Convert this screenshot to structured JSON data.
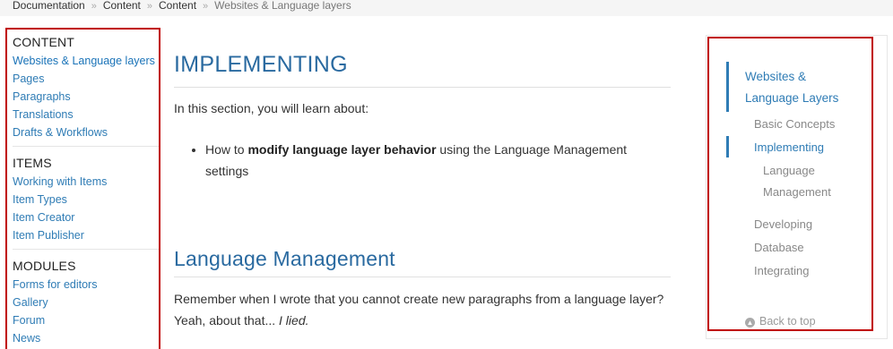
{
  "breadcrumb": [
    "Documentation",
    "Content",
    "Content",
    "Websites & Language layers"
  ],
  "sidebar": {
    "sections": [
      {
        "heading": "CONTENT",
        "items": [
          "Websites & Language layers",
          "Pages",
          "Paragraphs",
          "Translations",
          "Drafts & Workflows"
        ]
      },
      {
        "heading": "ITEMS",
        "items": [
          "Working with Items",
          "Item Types",
          "Item Creator",
          "Item Publisher"
        ]
      },
      {
        "heading": "MODULES",
        "items": [
          "Forms for editors",
          "Gallery",
          "Forum",
          "News"
        ]
      }
    ]
  },
  "main": {
    "heading_implementing": "IMPLEMENTING",
    "intro": "In this section, you will learn about:",
    "bullet": {
      "prefix": "How to ",
      "bold": "modify language layer behavior",
      "suffix": " using the Language Management settings"
    },
    "heading_language": "Language Management",
    "para_text": "Remember when I wrote that you cannot create new paragraphs from a language layer? Yeah, about that... ",
    "para_italic": "I lied."
  },
  "toc": {
    "title_line1": "Websites &",
    "title_line2": "Language Layers",
    "items": {
      "basic": "Basic Concepts",
      "implementing": "Implementing",
      "langmgmt_line1": "Language",
      "langmgmt_line2": "Management",
      "developing": "Developing",
      "database": "Database",
      "integrating": "Integrating"
    },
    "back_to_top": "Back to top"
  },
  "colors": {
    "accent": "#2f7cb5",
    "heading": "#2a6aa0",
    "highlight_border": "#c00000"
  }
}
